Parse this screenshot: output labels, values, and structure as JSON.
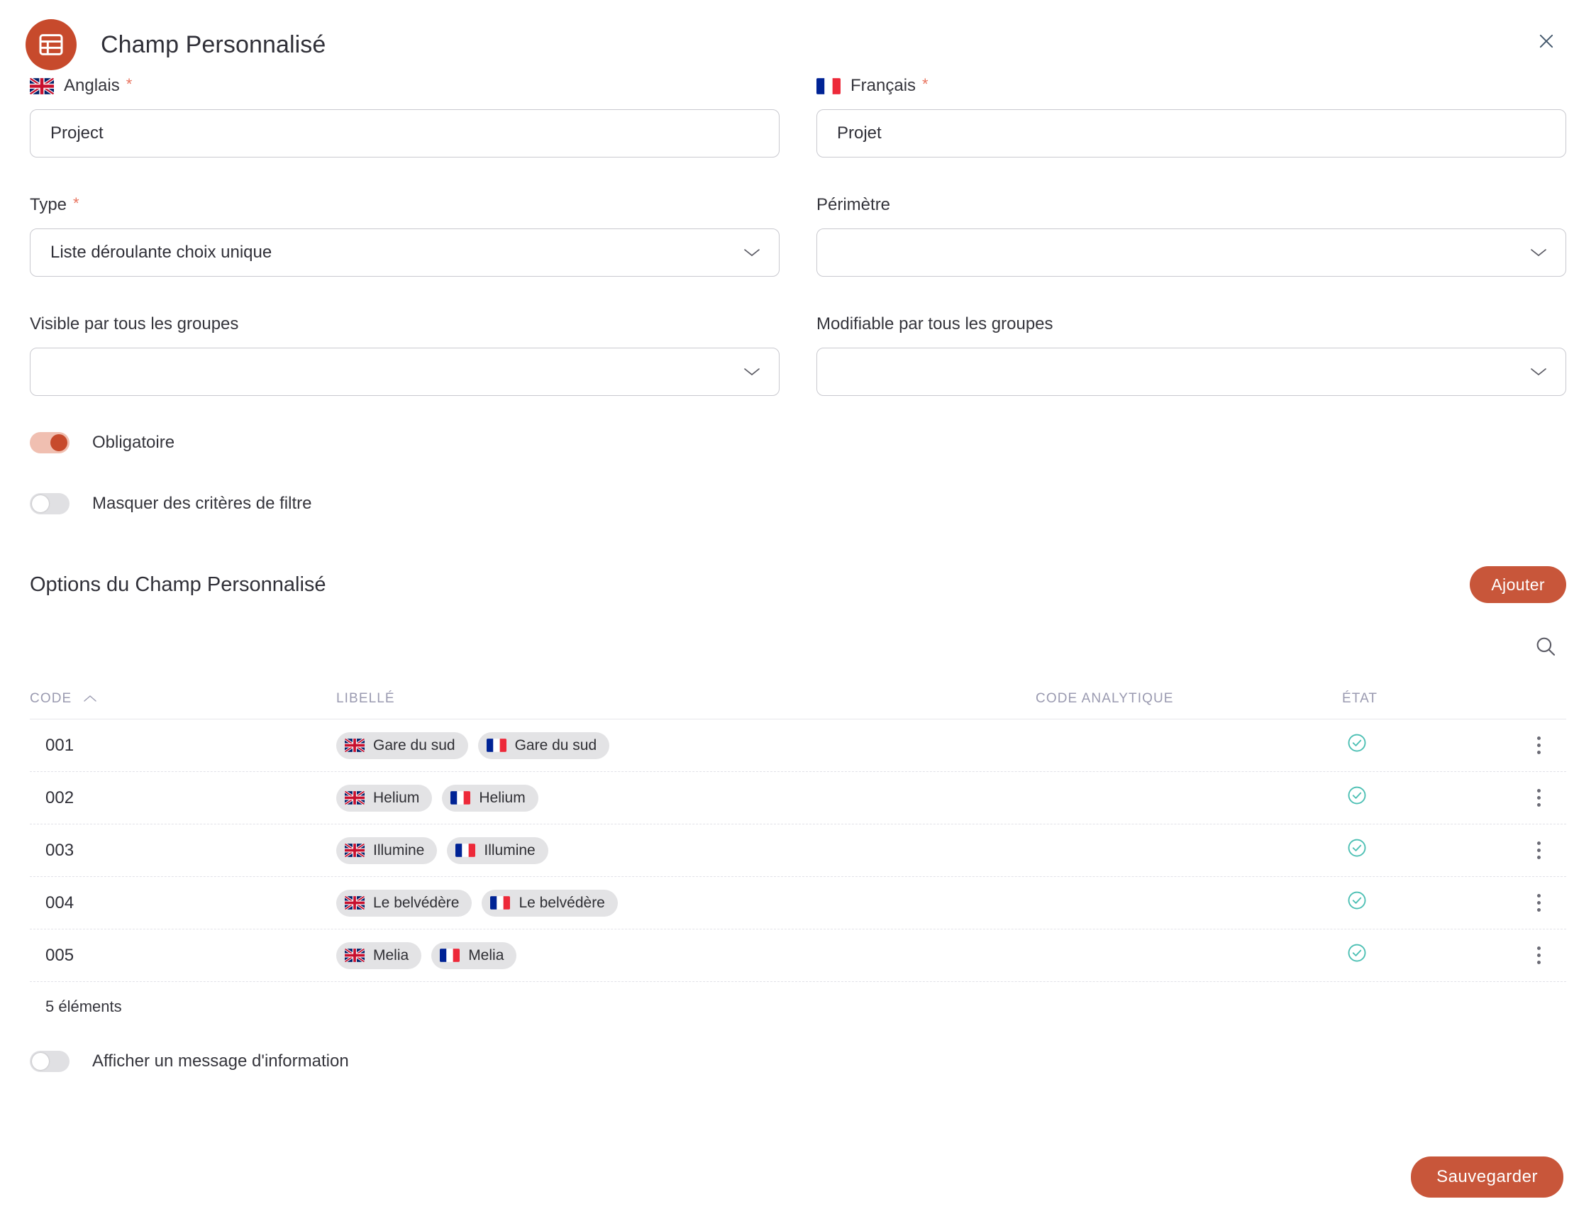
{
  "header": {
    "title": "Champ Personnalisé",
    "icon": "table-grid-icon",
    "close_icon": "close-icon",
    "accent_color": "#c74a2c"
  },
  "form": {
    "english": {
      "label": "Anglais",
      "required_marker": "*",
      "flag": "uk-flag-icon",
      "value": "Project"
    },
    "french": {
      "label": "Français",
      "required_marker": "*",
      "flag": "fr-flag-icon",
      "value": "Projet"
    },
    "type": {
      "label": "Type",
      "required_marker": "*",
      "value": "Liste déroulante choix unique"
    },
    "perimetre": {
      "label": "Périmètre",
      "value": ""
    },
    "visible_groups": {
      "label": "Visible par tous les groupes",
      "value": ""
    },
    "editable_groups": {
      "label": "Modifiable par tous les groupes",
      "value": ""
    },
    "toggles": {
      "obligatoire": {
        "label": "Obligatoire",
        "state": "on"
      },
      "masquer_filtre": {
        "label": "Masquer des critères de filtre",
        "state": "off"
      },
      "afficher_message": {
        "label": "Afficher un message d'information",
        "state": "off"
      }
    }
  },
  "options_section": {
    "title": "Options du Champ Personnalisé",
    "add_button": "Ajouter",
    "search_icon": "search-icon",
    "columns": {
      "code": "CODE",
      "libelle": "LIBELLÉ",
      "code_analytique": "CODE ANALYTIQUE",
      "etat": "ÉTAT"
    },
    "sort": {
      "column": "CODE",
      "direction": "asc",
      "icon": "chevron-up-icon"
    },
    "rows": [
      {
        "code": "001",
        "label_en": "Gare du sud",
        "label_fr": "Gare du sud",
        "code_analytique": "",
        "etat": "active"
      },
      {
        "code": "002",
        "label_en": "Helium",
        "label_fr": "Helium",
        "code_analytique": "",
        "etat": "active"
      },
      {
        "code": "003",
        "label_en": "Illumine",
        "label_fr": "Illumine",
        "code_analytique": "",
        "etat": "active"
      },
      {
        "code": "004",
        "label_en": "Le belvédère",
        "label_fr": "Le belvédère",
        "code_analytique": "",
        "etat": "active"
      },
      {
        "code": "005",
        "label_en": "Melia",
        "label_fr": "Melia",
        "code_analytique": "",
        "etat": "active"
      }
    ],
    "count_label": "5 éléments",
    "status_color": "#4bbfb3"
  },
  "footer": {
    "save_label": "Sauvegarder"
  }
}
